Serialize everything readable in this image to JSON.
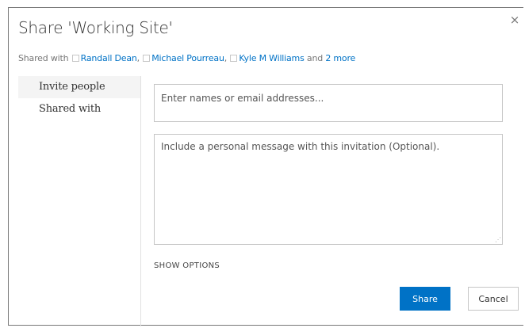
{
  "dialog": {
    "title": "Share 'Working Site'",
    "close_glyph": "×"
  },
  "shared_with": {
    "prefix": "Shared with",
    "people": [
      "Randall Dean",
      "Michael Pourreau",
      "Kyle M Williams"
    ],
    "separators": [
      ",",
      ",",
      ""
    ],
    "and_text": " and ",
    "more_link": "2 more"
  },
  "nav": {
    "items": [
      {
        "label": "Invite people",
        "selected": true
      },
      {
        "label": "Shared with",
        "selected": false
      }
    ]
  },
  "form": {
    "names_placeholder": "Enter names or email addresses...",
    "names_value": "",
    "message_placeholder": "Include a personal message with this invitation (Optional).",
    "message_value": "",
    "show_options_label": "SHOW OPTIONS"
  },
  "buttons": {
    "share_label": "Share",
    "cancel_label": "Cancel"
  },
  "colors": {
    "accent": "#0072c6",
    "link": "#0072c6",
    "nav_selected_bg": "#f4f4f4"
  },
  "icons": {
    "close": "close-icon",
    "avatar_placeholder": "person-checkbox-icon",
    "resize": "resize-grip-icon"
  }
}
